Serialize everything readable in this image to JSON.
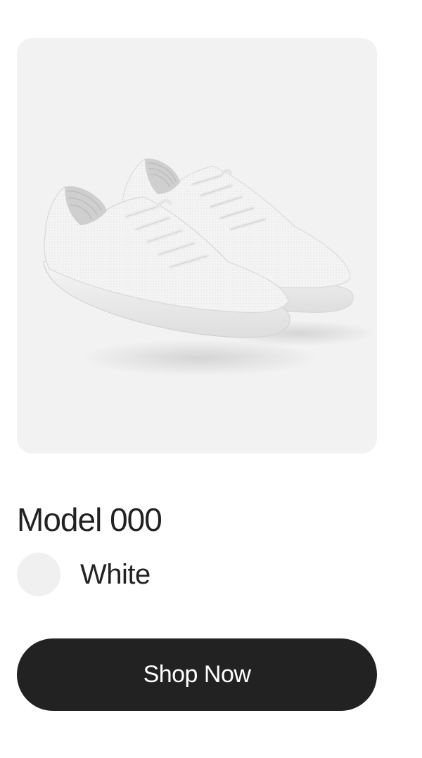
{
  "product": {
    "name": "Model 000",
    "image_alt": "Pair of white knit sneakers",
    "color": {
      "label": "White",
      "swatch_hex": "#f0f0f0"
    },
    "cta_label": "Shop Now"
  },
  "colors": {
    "tile_background": "#f2f2f2",
    "text": "#222222",
    "button_background": "#222222",
    "button_text": "#ffffff"
  }
}
